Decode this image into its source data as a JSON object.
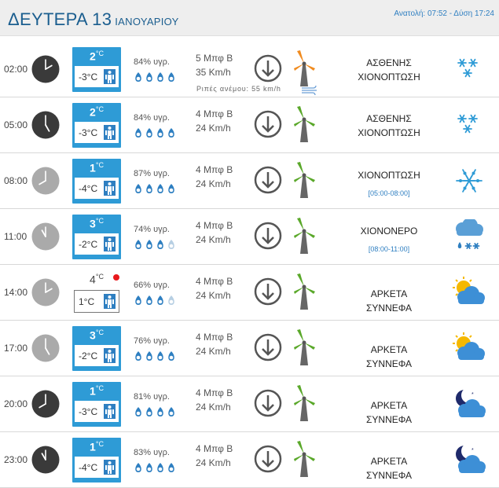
{
  "header": {
    "day": "ΔΕΥΤΕΡΑ 13",
    "month": "ΙΑΝΟΥΑΡΙΟΥ",
    "sun": "Ανατολή: 07:52 - Δύση 17:24"
  },
  "colors": {
    "accent": "#2e9bd6",
    "title": "#1b5e8f",
    "wind_green": "#5aa82a",
    "wind_orange": "#f08b1f",
    "alert": "#e8191c"
  },
  "rows": [
    {
      "time": "02:00",
      "clock": "dark",
      "temp": "2",
      "unit": "°C",
      "feels": "-3°C",
      "humidity": "84% υγρ.",
      "drops_full": 4,
      "wind": "5 Μπφ Β",
      "speed": "35 Km/h",
      "gust": "Ριπές ανέμου: 55 km/h",
      "turbine": "orange",
      "condition": "ΑΣΘΕΝΗΣ ΧΙΟΝΟΠΤΩΣΗ",
      "range": "",
      "icon": "snowflakes-icon"
    },
    {
      "time": "05:00",
      "clock": "dark",
      "temp": "2",
      "unit": "°C",
      "feels": "-3°C",
      "humidity": "84% υγρ.",
      "drops_full": 4,
      "wind": "4 Μπφ Β",
      "speed": "24 Km/h",
      "gust": "",
      "turbine": "green",
      "condition": "ΑΣΘΕΝΗΣ ΧΙΟΝΟΠΤΩΣΗ",
      "range": "",
      "icon": "snowflakes-icon"
    },
    {
      "time": "08:00",
      "clock": "light",
      "temp": "1",
      "unit": "°C",
      "feels": "-4°C",
      "humidity": "87% υγρ.",
      "drops_full": 4,
      "wind": "4 Μπφ Β",
      "speed": "24 Km/h",
      "gust": "",
      "turbine": "green",
      "condition": "ΧΙΟΝΟΠΤΩΣΗ",
      "range": "[05:00-08:00]",
      "icon": "snowflake-icon"
    },
    {
      "time": "11:00",
      "clock": "light",
      "temp": "3",
      "unit": "°C",
      "feels": "-2°C",
      "humidity": "74% υγρ.",
      "drops_full": 3,
      "wind": "4 Μπφ Β",
      "speed": "24 Km/h",
      "gust": "",
      "turbine": "green",
      "condition": "ΧΙΟΝΟΝΕΡΟ",
      "range": "[08:00-11:00]",
      "icon": "sleet-icon"
    },
    {
      "time": "14:00",
      "clock": "light",
      "temp": "4",
      "unit": "°C",
      "feels": "1°C",
      "humidity": "66% υγρ.",
      "drops_full": 3,
      "wind": "4 Μπφ Β",
      "speed": "24 Km/h",
      "gust": "",
      "turbine": "green",
      "condition": "ΑΡΚΕΤΑ ΣΥΝΝΕΦΑ",
      "range": "",
      "icon": "sun-cloud-icon",
      "alt": true
    },
    {
      "time": "17:00",
      "clock": "light",
      "temp": "3",
      "unit": "°C",
      "feels": "-2°C",
      "humidity": "76% υγρ.",
      "drops_full": 4,
      "wind": "4 Μπφ Β",
      "speed": "24 Km/h",
      "gust": "",
      "turbine": "green",
      "condition": "ΑΡΚΕΤΑ ΣΥΝΝΕΦΑ",
      "range": "",
      "icon": "sun-cloud-icon"
    },
    {
      "time": "20:00",
      "clock": "dark",
      "temp": "1",
      "unit": "°C",
      "feels": "-3°C",
      "humidity": "81% υγρ.",
      "drops_full": 4,
      "wind": "4 Μπφ Β",
      "speed": "24 Km/h",
      "gust": "",
      "turbine": "green",
      "condition": "ΑΡΚΕΤΑ ΣΥΝΝΕΦΑ",
      "range": "",
      "icon": "moon-cloud-icon"
    },
    {
      "time": "23:00",
      "clock": "dark",
      "temp": "1",
      "unit": "°C",
      "feels": "-4°C",
      "humidity": "83% υγρ.",
      "drops_full": 4,
      "wind": "4 Μπφ Β",
      "speed": "24 Km/h",
      "gust": "",
      "turbine": "green",
      "condition": "ΑΡΚΕΤΑ ΣΥΝΝΕΦΑ",
      "range": "",
      "icon": "moon-cloud-icon"
    }
  ]
}
